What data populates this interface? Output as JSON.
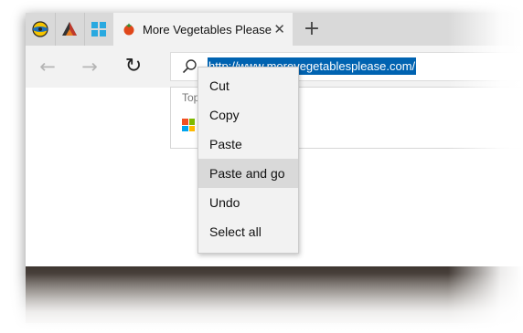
{
  "tabs": {
    "pinned": [
      {
        "icon": "globe-app-icon"
      },
      {
        "icon": "triangle-app-icon"
      },
      {
        "icon": "windows-logo-icon"
      }
    ],
    "active": {
      "icon": "tomato-icon",
      "title": "More Vegetables Please",
      "close_symbol": "✕"
    },
    "new_tab_symbol": "+"
  },
  "nav": {
    "back_symbol": "←",
    "forward_symbol": "→",
    "refresh_symbol": "↻"
  },
  "address_bar": {
    "selected_url_text": "http://www.morevegetablesplease.com/"
  },
  "dropdown": {
    "heading": "Top sites"
  },
  "context_menu": {
    "items": [
      "Cut",
      "Copy",
      "Paste",
      "Paste and go",
      "Undo",
      "Select all"
    ],
    "highlighted": "Paste and go"
  },
  "colors": {
    "selection": "#0063b1",
    "tab_strip": "#d9d9d9",
    "toolbar": "#f2f2f2",
    "menu_highlight": "#d9d9d9"
  }
}
